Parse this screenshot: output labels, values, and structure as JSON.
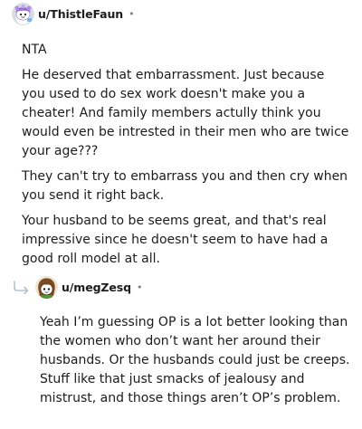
{
  "comments": [
    {
      "username": "u/ThistleFaun",
      "separator": "•",
      "avatar": "reddit-snoo-avatar-purple",
      "paragraphs": [
        "NTA",
        "He deserved that embarrassment. Just because you used to do sex work doesn't make you a cheater! And family members actully think you would even be intrested in their men who are twice your age???",
        "They can't try to embarrass you and then cry when you send it right back.",
        "Your husband to be seems great, and that's real impressive since he doesn't seem to have had a good roll model at all."
      ]
    },
    {
      "username": "u/megZesq",
      "separator": "•",
      "avatar": "reddit-snoo-avatar-brown-hair",
      "reply_icon": "reply-arrow-icon",
      "paragraphs": [
        "Yeah I’m guessing OP is a lot better looking than the women who don’t want her around their husbands. Or the husbands could just be creeps. Stuff like that just smacks of jealousy and mistrust, and those things aren’t OP’s problem."
      ]
    }
  ],
  "colors": {
    "text": "#1c1c1c",
    "meta": "#7c7c7c",
    "reply_icon": "#b7c4cc",
    "avatar1_bg": "#d6dce3",
    "avatar2_bg": "#eee3cf"
  }
}
